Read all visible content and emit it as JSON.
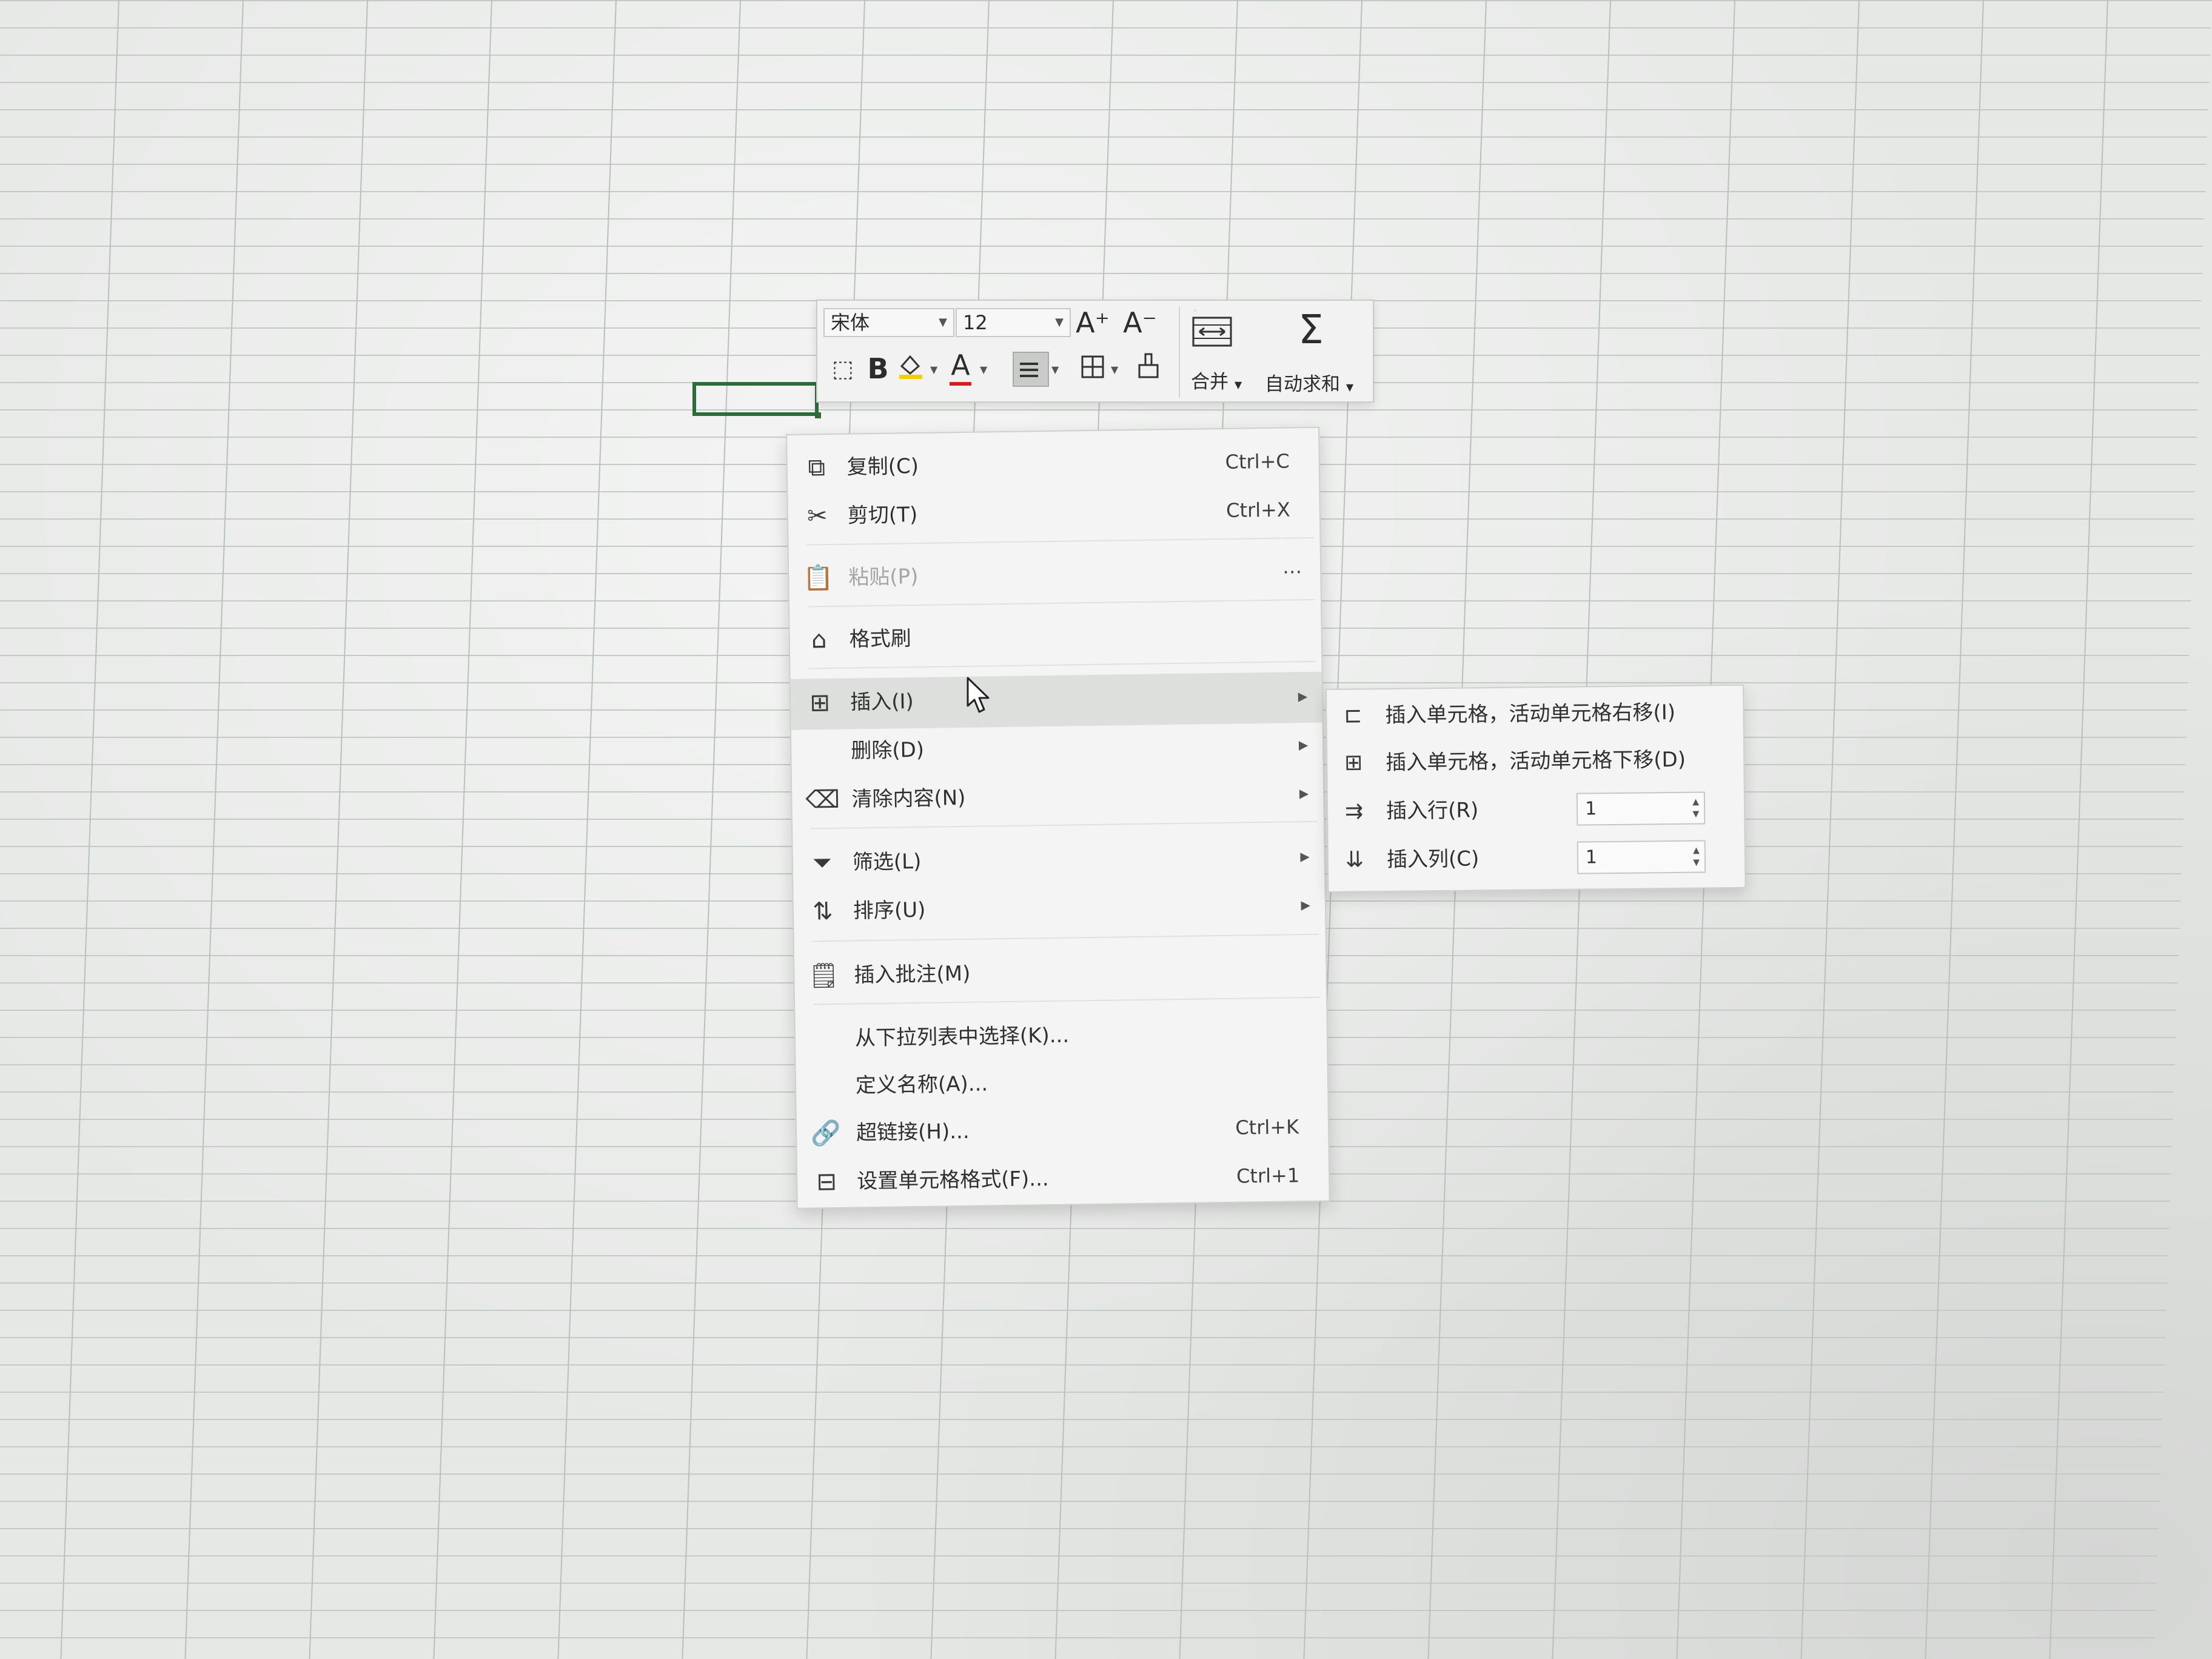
{
  "mini_toolbar": {
    "font_name": "宋体",
    "font_size": "12",
    "grow_font_icon": "A⁺",
    "shrink_font_icon": "A⁻",
    "bold": "B",
    "font_color_letter": "A",
    "merge_label": "合并",
    "autosum_label": "自动求和",
    "sigma": "Σ"
  },
  "context_menu": {
    "copy": {
      "label": "复制(C)",
      "shortcut": "Ctrl+C"
    },
    "cut": {
      "label": "剪切(T)",
      "shortcut": "Ctrl+X"
    },
    "paste": {
      "label": "粘贴(P)",
      "more": "⋯"
    },
    "format_painter": {
      "label": "格式刷"
    },
    "insert": {
      "label": "插入(I)"
    },
    "delete": {
      "label": "删除(D)"
    },
    "clear": {
      "label": "清除内容(N)"
    },
    "filter": {
      "label": "筛选(L)"
    },
    "sort": {
      "label": "排序(U)"
    },
    "insert_comment": {
      "label": "插入批注(M)"
    },
    "pick_list": {
      "label": "从下拉列表中选择(K)..."
    },
    "define_name": {
      "label": "定义名称(A)..."
    },
    "hyperlink": {
      "label": "超链接(H)...",
      "shortcut": "Ctrl+K"
    },
    "format_cells": {
      "label": "设置单元格格式(F)...",
      "shortcut": "Ctrl+1"
    }
  },
  "insert_submenu": {
    "shift_right": "插入单元格，活动单元格右移(I)",
    "shift_down": "插入单元格，活动单元格下移(D)",
    "insert_row": {
      "label": "插入行(R)",
      "value": "1"
    },
    "insert_col": {
      "label": "插入列(C)",
      "value": "1"
    }
  },
  "colors": {
    "active_cell_border": "#2e6b3a",
    "font_color_bar": "#d42020",
    "fill_color_bar": "#f0d000"
  }
}
